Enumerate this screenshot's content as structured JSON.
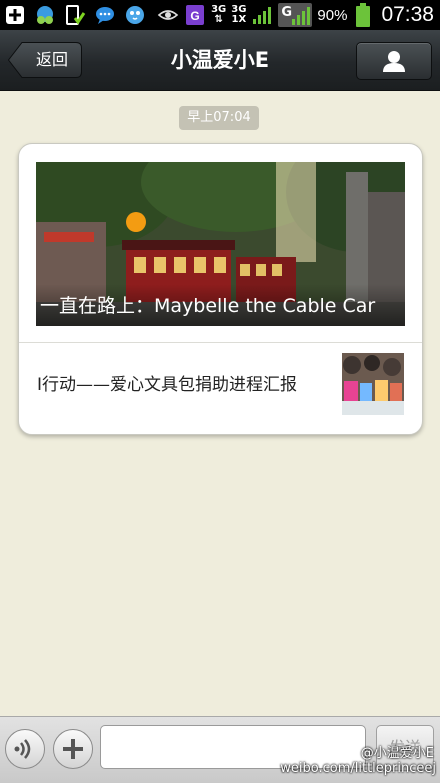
{
  "status_bar": {
    "network_3g_a": "3G",
    "network_3g_b": "3G",
    "network_1x": "1X",
    "network_g": "G",
    "battery_percent": "90%",
    "time": "07:38",
    "icons": [
      "add-box-icon",
      "cloud-app-icon",
      "phone-check-icon",
      "chat-bubble-icon",
      "bird-app-icon",
      "eye-icon",
      "g-app-icon",
      "signal-icon",
      "battery-icon"
    ]
  },
  "header": {
    "back_label": "返回",
    "title": "小温爱小E",
    "profile_icon": "person-icon"
  },
  "chat": {
    "timestamp": "早上07:04",
    "card": {
      "hero_title": "一直在路上：Maybelle the Cable Car",
      "item_title": "I行动——爱心文具包捐助进程汇报"
    }
  },
  "input_bar": {
    "voice_icon": "voice-icon",
    "add_icon": "plus-icon",
    "message_value": "",
    "send_label": "发送"
  },
  "watermark": {
    "handle": "@小温爱小E",
    "url": "weibo.com/littleprinceej"
  },
  "colors": {
    "title_bar": "#23272a",
    "chat_background": "#efeddc",
    "battery_green": "#6cc33a"
  }
}
